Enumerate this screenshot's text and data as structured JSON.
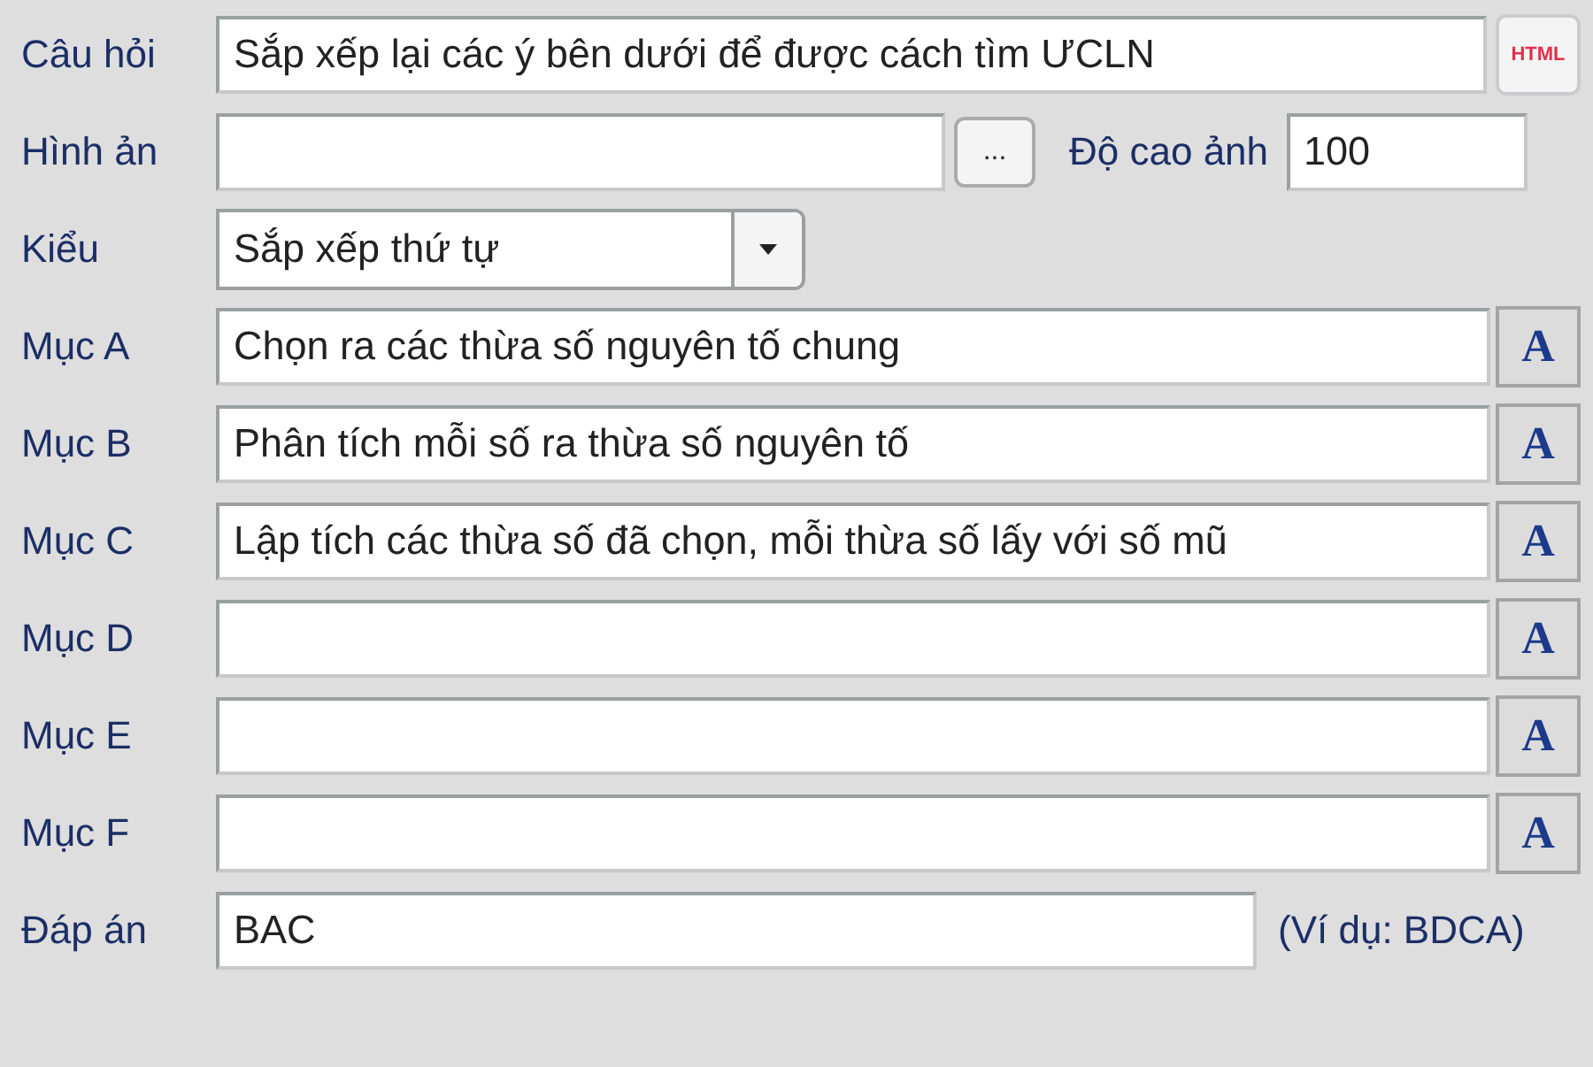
{
  "rows": [
    {
      "kind": "text",
      "label": "Câu hỏi",
      "value": "Sắp xếp lại các ý bên dưới để được cách tìm ƯCLN",
      "button": {
        "kind": "html",
        "label": "HTML"
      }
    },
    {
      "kind": "image",
      "label": "Hình ản",
      "browse": "...",
      "height_label": "Độ cao ảnh",
      "height_value": "100"
    },
    {
      "kind": "select",
      "label": "Kiểu",
      "value": "Sắp xếp thứ tự"
    },
    {
      "kind": "text",
      "label": "Mục A",
      "value": "Chọn ra các thừa số nguyên tố chung",
      "button": {
        "kind": "font",
        "label": "A"
      }
    },
    {
      "kind": "text",
      "label": "Mục B",
      "value": "Phân tích mỗi số ra thừa số nguyên tố",
      "button": {
        "kind": "font",
        "label": "A"
      }
    },
    {
      "kind": "text",
      "label": "Mục C",
      "value": "Lập tích các thừa số đã chọn, mỗi thừa số lấy với số mũ",
      "button": {
        "kind": "font",
        "label": "A"
      }
    },
    {
      "kind": "text",
      "label": "Mục D",
      "button": {
        "kind": "font",
        "label": "A"
      }
    },
    {
      "kind": "text",
      "label": "Mục E",
      "button": {
        "kind": "font",
        "label": "A"
      }
    },
    {
      "kind": "text",
      "label": "Mục F",
      "button": {
        "kind": "font",
        "label": "A"
      }
    },
    {
      "kind": "answer",
      "label": "Đáp án",
      "value": "BAC",
      "hint": "(Ví dụ: BDCA)"
    }
  ]
}
